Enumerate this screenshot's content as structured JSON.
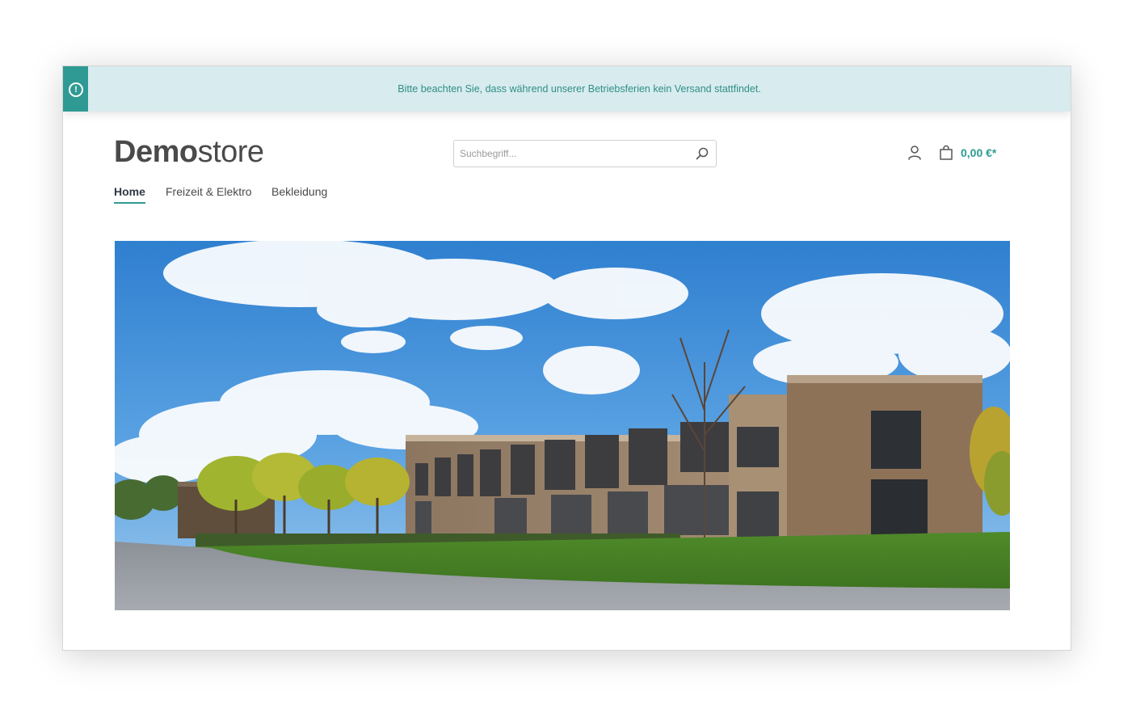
{
  "notice": {
    "text": "Bitte beachten Sie, dass während unserer Betriebsferien kein Versand stattfindet.",
    "icon": "info-circle-icon"
  },
  "header": {
    "logo_bold": "Demo",
    "logo_light": "store",
    "search_placeholder": "Suchbegriff...",
    "cart_total": "0,00 €*"
  },
  "nav": {
    "items": [
      {
        "label": "Home",
        "active": true
      },
      {
        "label": "Freizeit & Elektro",
        "active": false
      },
      {
        "label": "Bekleidung",
        "active": false
      }
    ]
  },
  "colors": {
    "accent": "#2e9a93",
    "notice_bg": "#d8ebee",
    "text": "#4a4a4a"
  },
  "hero": {
    "alt": "hero-banner-building-photo"
  }
}
